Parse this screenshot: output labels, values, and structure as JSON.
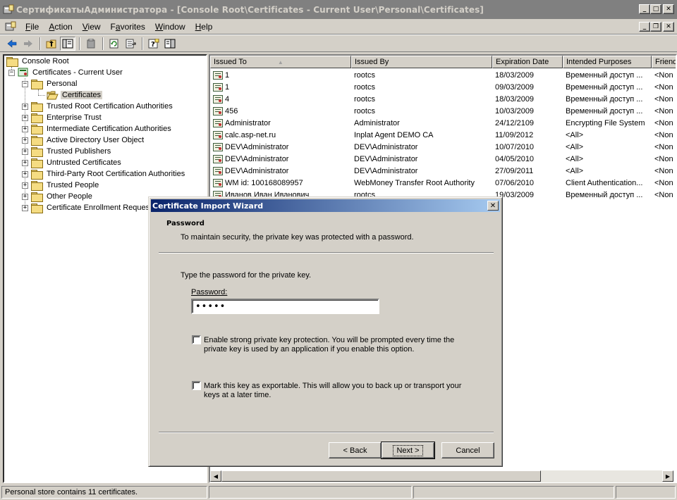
{
  "window": {
    "title": "СертификатыАдминистратора - [Console Root\\Certificates - Current User\\Personal\\Certificates]"
  },
  "menu": [
    {
      "key": "F",
      "rest": "ile"
    },
    {
      "key": "A",
      "rest": "ction"
    },
    {
      "key": "V",
      "rest": "iew"
    },
    {
      "key": "",
      "pre": "F",
      "u": "a",
      "rest": "vorites"
    },
    {
      "key": "W",
      "rest": "indow"
    },
    {
      "key": "H",
      "rest": "elp"
    }
  ],
  "tree": {
    "root": "Console Root",
    "store": "Certificates - Current User",
    "personal": "Personal",
    "certificates": "Certificates",
    "folders": [
      "Trusted Root Certification Authorities",
      "Enterprise Trust",
      "Intermediate Certification Authorities",
      "Active Directory User Object",
      "Trusted Publishers",
      "Untrusted Certificates",
      "Third-Party Root Certification Authorities",
      "Trusted People",
      "Other People",
      "Certificate Enrollment Reques"
    ]
  },
  "list": {
    "columns": [
      "Issued To",
      "Issued By",
      "Expiration Date",
      "Intended Purposes",
      "Friend"
    ],
    "sort_indicator": "▲",
    "rows": [
      [
        "1",
        "rootcs",
        "18/03/2009",
        "Временный доступ ...",
        "<Non"
      ],
      [
        "1",
        "rootcs",
        "09/03/2009",
        "Временный доступ ...",
        "<Non"
      ],
      [
        "4",
        "rootcs",
        "18/03/2009",
        "Временный доступ ...",
        "<Non"
      ],
      [
        "456",
        "rootcs",
        "10/03/2009",
        "Временный доступ ...",
        "<Non"
      ],
      [
        "Administrator",
        "Administrator",
        "24/12/2109",
        "Encrypting File System",
        "<Non"
      ],
      [
        "calc.asp-net.ru",
        "Inplat Agent DEMO CA",
        "11/09/2012",
        "<All>",
        "<Non"
      ],
      [
        "DEV\\Administrator",
        "DEV\\Administrator",
        "10/07/2010",
        "<All>",
        "<Non"
      ],
      [
        "DEV\\Administrator",
        "DEV\\Administrator",
        "04/05/2010",
        "<All>",
        "<Non"
      ],
      [
        "DEV\\Administrator",
        "DEV\\Administrator",
        "27/09/2011",
        "<All>",
        "<Non"
      ],
      [
        "WM id: 100168089957",
        "WebMoney Transfer Root Authority",
        "07/06/2010",
        "Client Authentication...",
        "<Non"
      ],
      [
        "Иванов Иван Иванович",
        "rootcs",
        "19/03/2009",
        "Временный доступ ...",
        "<Non"
      ]
    ]
  },
  "status": {
    "text": "Personal store contains 11 certificates."
  },
  "dialog": {
    "title": "Certificate Import Wizard",
    "header_title": "Password",
    "header_sub": "To maintain security, the private key was protected with a password.",
    "prompt": "Type the password for the private key.",
    "password_label": "Password:",
    "password_value": "•••••",
    "strong_line1": "Enable strong private key protection. You will be prompted every time the",
    "strong_line2": "private key is used by an application if you enable this option.",
    "export_line1": "Mark this key as exportable. This will allow you to back up or transport your",
    "export_line2": "keys at a later time.",
    "back_label": "< Back",
    "next_label": "Next >",
    "cancel_label": "Cancel",
    "strong_checked": false,
    "export_checked": false
  }
}
